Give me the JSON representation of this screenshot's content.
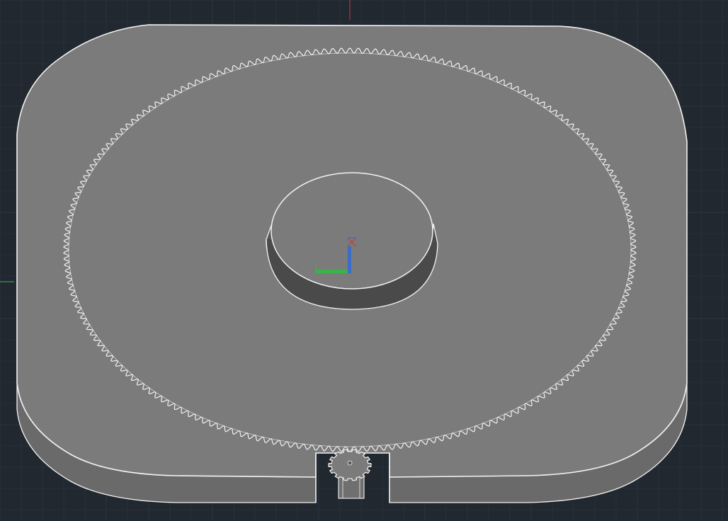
{
  "viewport": {
    "background": "#212830",
    "grid_color": "#2c3440",
    "model_fill": "#7b7b7b",
    "edge_color": "#f2f2f2"
  },
  "model": {
    "plate": "rounded-rectangle-base-plate",
    "ring_gear": "internal-ring-gear",
    "hub": "center-cylinder-boss",
    "pinion": "small-pinion-gear"
  },
  "ucs_icon": {
    "axes": [
      "X",
      "Y",
      "Z"
    ],
    "colors": {
      "x": "#3cb34a",
      "z": "#3a6cc8",
      "crosshair": "#c43c3c"
    }
  }
}
